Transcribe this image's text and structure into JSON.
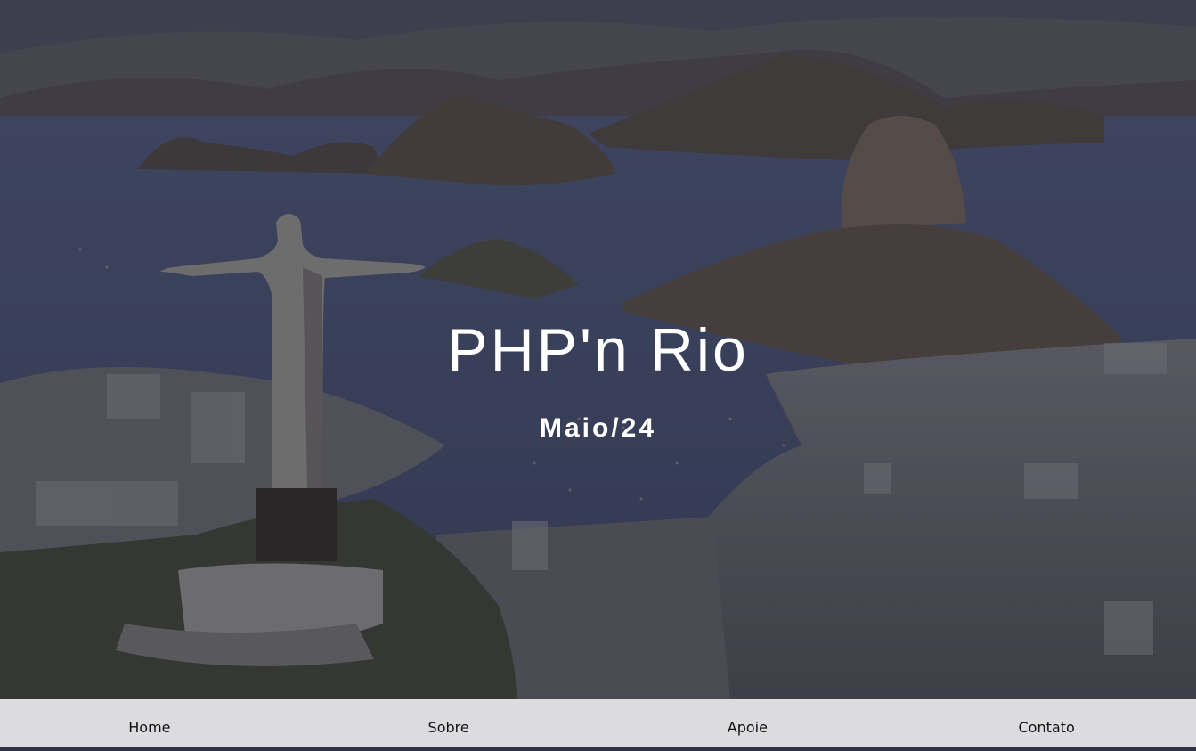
{
  "hero": {
    "title": "PHP'n Rio",
    "subtitle": "Maio/24",
    "background": "rio-de-janeiro-aerial-photo"
  },
  "nav": {
    "items": [
      {
        "label": "Home"
      },
      {
        "label": "Sobre"
      },
      {
        "label": "Apoie"
      },
      {
        "label": "Contato"
      }
    ]
  },
  "colors": {
    "text": "#ffffff",
    "nav_background": "#ececee",
    "nav_text": "#111111"
  }
}
